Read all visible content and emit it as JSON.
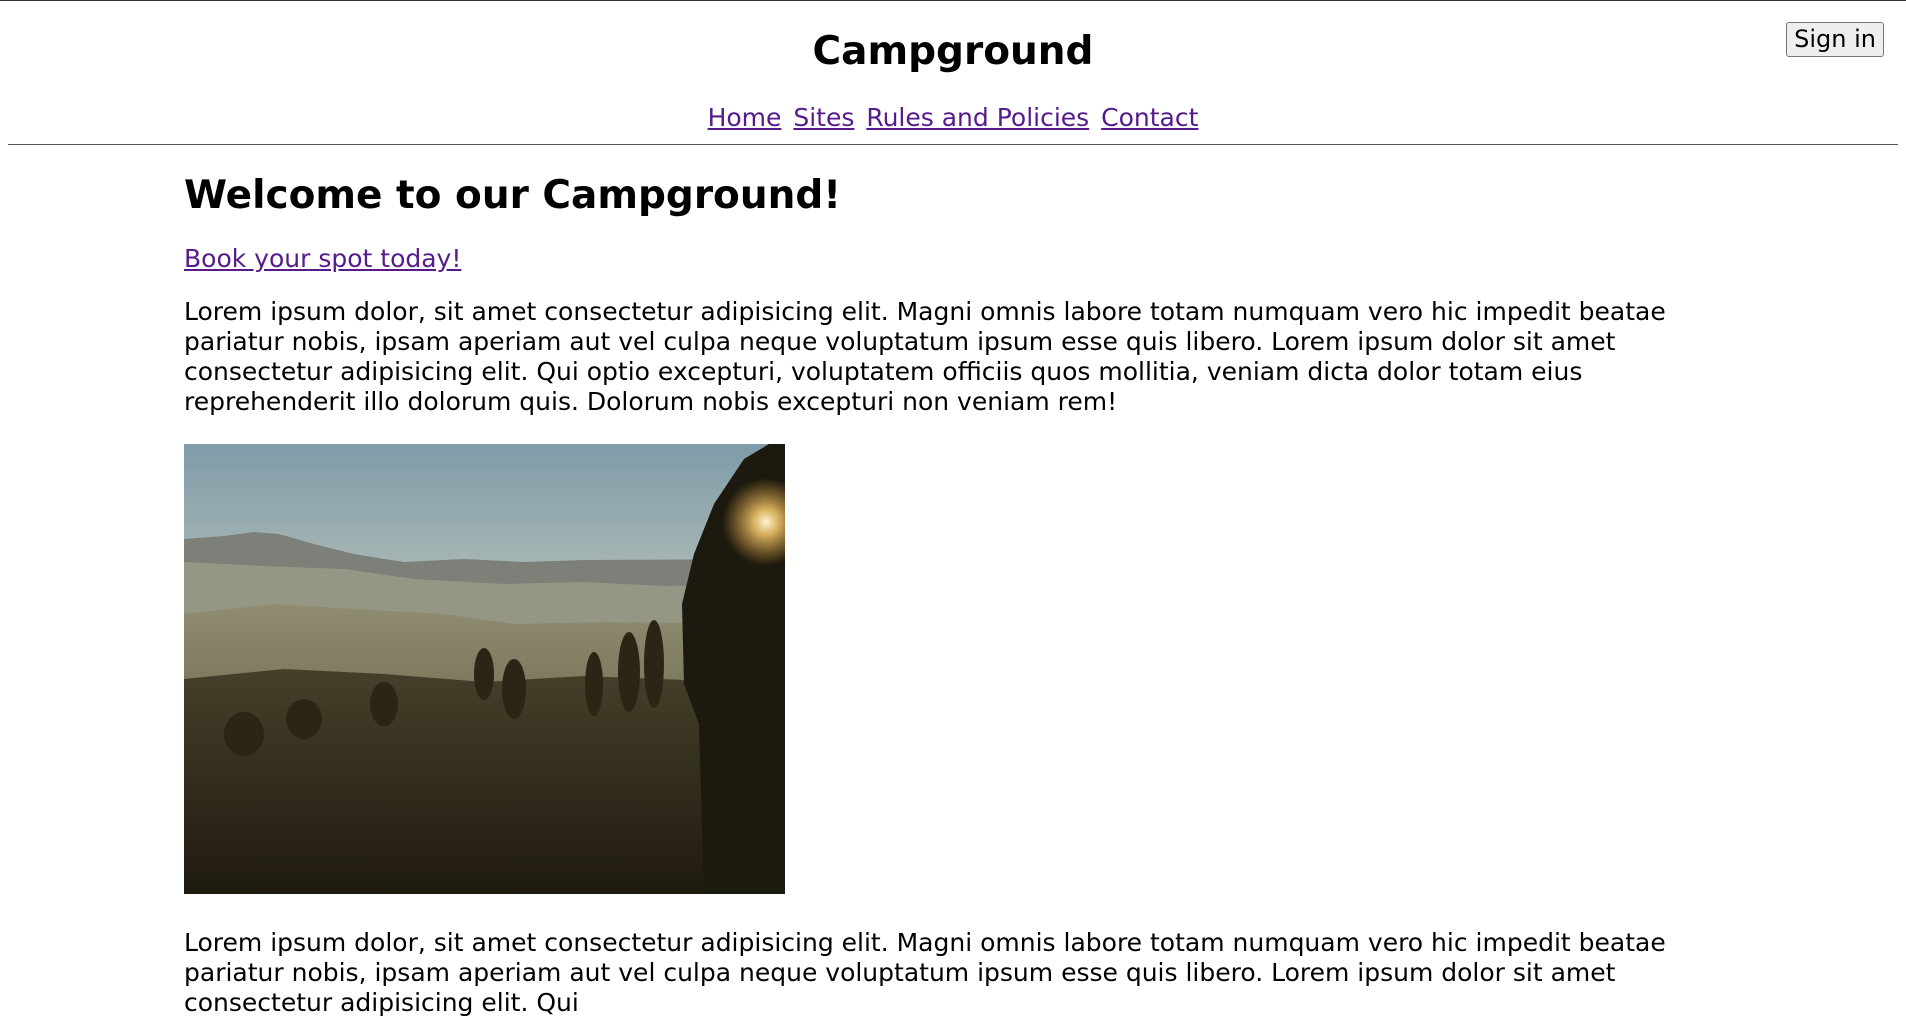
{
  "header": {
    "title": "Campground",
    "signin_label": "Sign in",
    "nav": [
      "Home",
      "Sites",
      "Rules and Policies",
      "Contact"
    ]
  },
  "main": {
    "heading": "Welcome to our Campground!",
    "book_link": "Book your spot today!",
    "paragraph1": "Lorem ipsum dolor, sit amet consectetur adipisicing elit. Magni omnis labore totam numquam vero hic impedit beatae pariatur nobis, ipsam aperiam aut vel culpa neque voluptatum ipsum esse quis libero. Lorem ipsum dolor sit amet consectetur adipisicing elit. Qui optio excepturi, voluptatem officiis quos mollitia, veniam dicta dolor totam eius reprehenderit illo dolorum quis. Dolorum nobis excepturi non veniam rem!",
    "paragraph2": "Lorem ipsum dolor, sit amet consectetur adipisicing elit. Magni omnis labore totam numquam vero hic impedit beatae pariatur nobis, ipsam aperiam aut vel culpa neque voluptatum ipsum esse quis libero. Lorem ipsum dolor sit amet consectetur adipisicing elit. Qui"
  },
  "colors": {
    "link": "#551a8b"
  }
}
